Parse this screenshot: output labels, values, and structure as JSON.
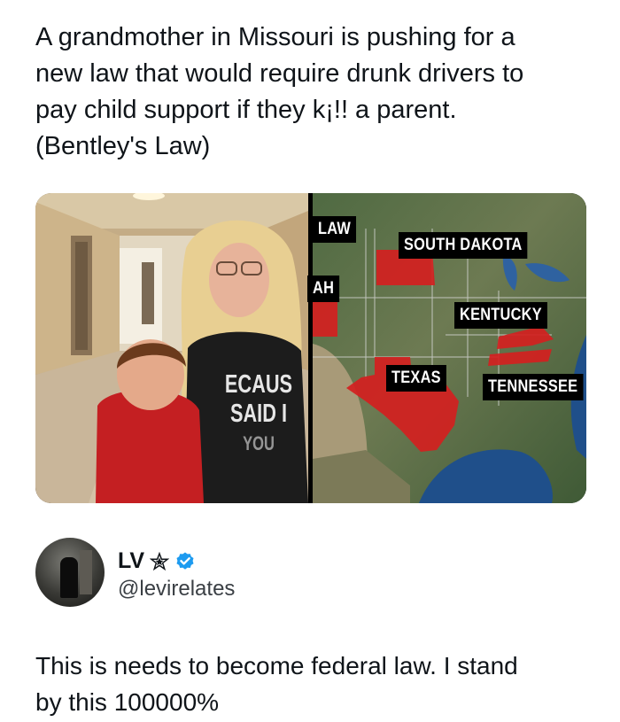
{
  "post": {
    "lines": [
      "A grandmother in Missouri is pushing for a",
      "new law that would require drunk drivers to",
      "pay child support if they k¡!! a parent.",
      "(Bentley's Law)"
    ]
  },
  "media": {
    "shirt_lines": [
      "ECAUS",
      "SAID I",
      "YOU"
    ],
    "map_labels": {
      "law": "LAW",
      "utah": "AH",
      "south_dakota": "SOUTH DAKOTA",
      "kentucky": "KENTUCKY",
      "texas": "TEXAS",
      "tennessee": "TENNESSEE"
    },
    "highlight_color": "#d42020"
  },
  "user": {
    "name": "LV",
    "handle": "@levirelates",
    "icons": [
      "star-icon",
      "verified-badge-icon"
    ],
    "verified_color": "#1d9bf0"
  },
  "reply": {
    "lines": [
      "This is needs to become federal law. I stand",
      "by this 100000%"
    ]
  }
}
